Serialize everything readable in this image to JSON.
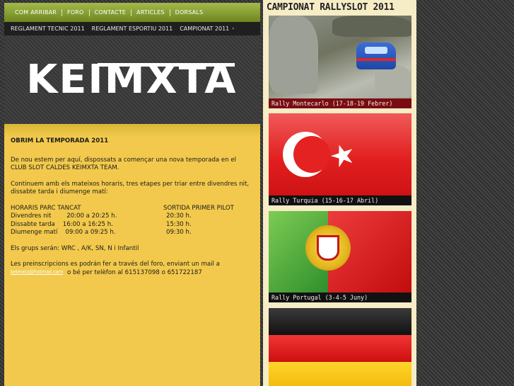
{
  "topnav": [
    "COM ARRIBAR",
    "FORO",
    "CONTACTE",
    "ARTICLES",
    "DORSALS"
  ],
  "subnav": {
    "items": [
      "REGLAMENT TECNIC 2011",
      "REGLAMENT ESPORTIU 2011",
      "CAMPIONAT 2011"
    ],
    "caret": "▾"
  },
  "logo": "KEIMXTA",
  "post": {
    "title": "OBRIM LA TEMPORADA 2011",
    "p1": "De nou estem per aquí, dispossats a començar una nova temporada en el CLUB SLOT CALDES KEIMXTA TEAM.",
    "p2": "Continuem amb els mateixos horaris, tres etapes per triar entre divendres nit, dissabte tarda i diumenge matí:",
    "schedule_headers": [
      "HORARIS PARC TANCAT",
      "SORTIDA PRIMER PILOT"
    ],
    "schedule": [
      {
        "day": "Divendres nit",
        "parc": "20:00 a 20:25 h.",
        "sortida": "20:30 h."
      },
      {
        "day": "Dissabte tarda",
        "parc": "16:00 a 16:25 h.",
        "sortida": "15:30 h."
      },
      {
        "day": "Diumenge matí",
        "parc": "09:00 a 09:25 h.",
        "sortida": "09:30 h."
      }
    ],
    "p3": "Els grups serán: WRC , A/K, SN, N i Infantil",
    "p4": "Les preinscripcions es podrán fer a través del foro, enviant un mail a",
    "p4b": "o bé per telèfon al 615137098 o 651722187",
    "email": "keimxta@hotmail.com"
  },
  "sidebar": {
    "title": "CAMPIONAT RALLYSLOT 2011",
    "cards": [
      {
        "caption": "Rally Montecarlo (17-18-19 Febrer)"
      },
      {
        "caption": "Rally Turquia (15-16-17 Abril)"
      },
      {
        "caption": "Rally Portugal (3-4-5 Juny)"
      },
      {
        "caption": ""
      }
    ]
  }
}
